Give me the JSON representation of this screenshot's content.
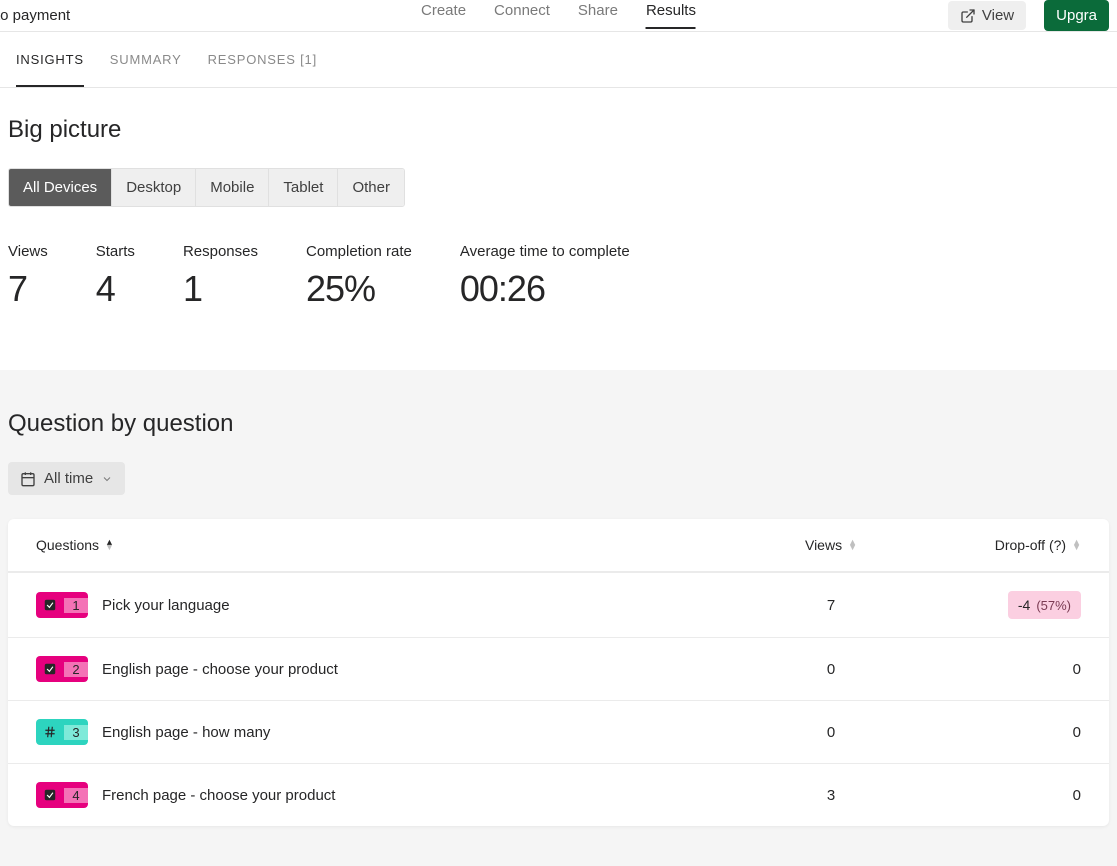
{
  "topbar": {
    "title_fragment": "to payment",
    "tabs": [
      {
        "label": "Create",
        "active": false
      },
      {
        "label": "Connect",
        "active": false
      },
      {
        "label": "Share",
        "active": false
      },
      {
        "label": "Results",
        "active": true
      }
    ],
    "view_label": "View",
    "upgrade_label": "Upgra"
  },
  "subtabs": [
    {
      "label": "INSIGHTS",
      "active": true
    },
    {
      "label": "SUMMARY",
      "active": false
    },
    {
      "label": "RESPONSES [1]",
      "active": false
    }
  ],
  "big_picture": {
    "heading": "Big picture",
    "device_tabs": [
      {
        "label": "All Devices",
        "active": true
      },
      {
        "label": "Desktop",
        "active": false
      },
      {
        "label": "Mobile",
        "active": false
      },
      {
        "label": "Tablet",
        "active": false
      },
      {
        "label": "Other",
        "active": false
      }
    ],
    "stats": [
      {
        "label": "Views",
        "value": "7"
      },
      {
        "label": "Starts",
        "value": "4"
      },
      {
        "label": "Responses",
        "value": "1"
      },
      {
        "label": "Completion rate",
        "value": "25%"
      },
      {
        "label": "Average time to complete",
        "value": "00:26"
      }
    ]
  },
  "qbq": {
    "heading": "Question by question",
    "alltime_label": "All time",
    "columns": {
      "q": "Questions",
      "views": "Views",
      "dropoff": "Drop-off (?)"
    },
    "rows": [
      {
        "num": "1",
        "kind": "check",
        "color": "pink",
        "title": "Pick your language",
        "views": "7",
        "dropoff": {
          "delta": "-4",
          "pct": "(57%)",
          "highlight": true
        }
      },
      {
        "num": "2",
        "kind": "check",
        "color": "pink",
        "title": "English page - choose your product",
        "views": "0",
        "dropoff": {
          "plain": "0"
        }
      },
      {
        "num": "3",
        "kind": "hash",
        "color": "teal",
        "title": "English page - how many",
        "views": "0",
        "dropoff": {
          "plain": "0"
        }
      },
      {
        "num": "4",
        "kind": "check",
        "color": "pink",
        "title": "French page - choose your product",
        "views": "3",
        "dropoff": {
          "plain": "0"
        }
      }
    ]
  }
}
